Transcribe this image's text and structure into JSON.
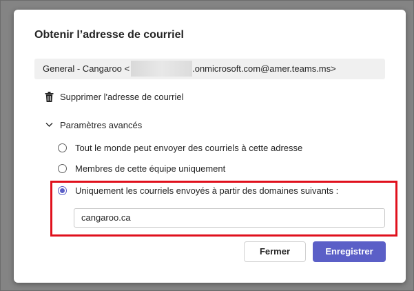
{
  "dialog": {
    "title": "Obtenir l’adresse de courriel",
    "address_prefix": "General - Cangaroo <",
    "address_suffix": ".onmicrosoft.com@amer.teams.ms>",
    "delete_label": "Supprimer l'adresse de courriel",
    "advanced_label": "Paramètres avancés",
    "options": [
      {
        "label": "Tout le monde peut envoyer des courriels à cette adresse",
        "checked": false
      },
      {
        "label": "Membres de cette équipe uniquement",
        "checked": false
      },
      {
        "label": "Uniquement les courriels envoyés à partir des domaines suivants :",
        "checked": true
      }
    ],
    "domains_value": "cangaroo.ca",
    "close_label": "Fermer",
    "save_label": "Enregistrer"
  },
  "colors": {
    "accent": "#5b5fc7",
    "highlight": "#e0101c",
    "overlay": "#848484"
  },
  "icons": {
    "delete": "trash-icon",
    "advanced": "chevron-down-icon"
  }
}
